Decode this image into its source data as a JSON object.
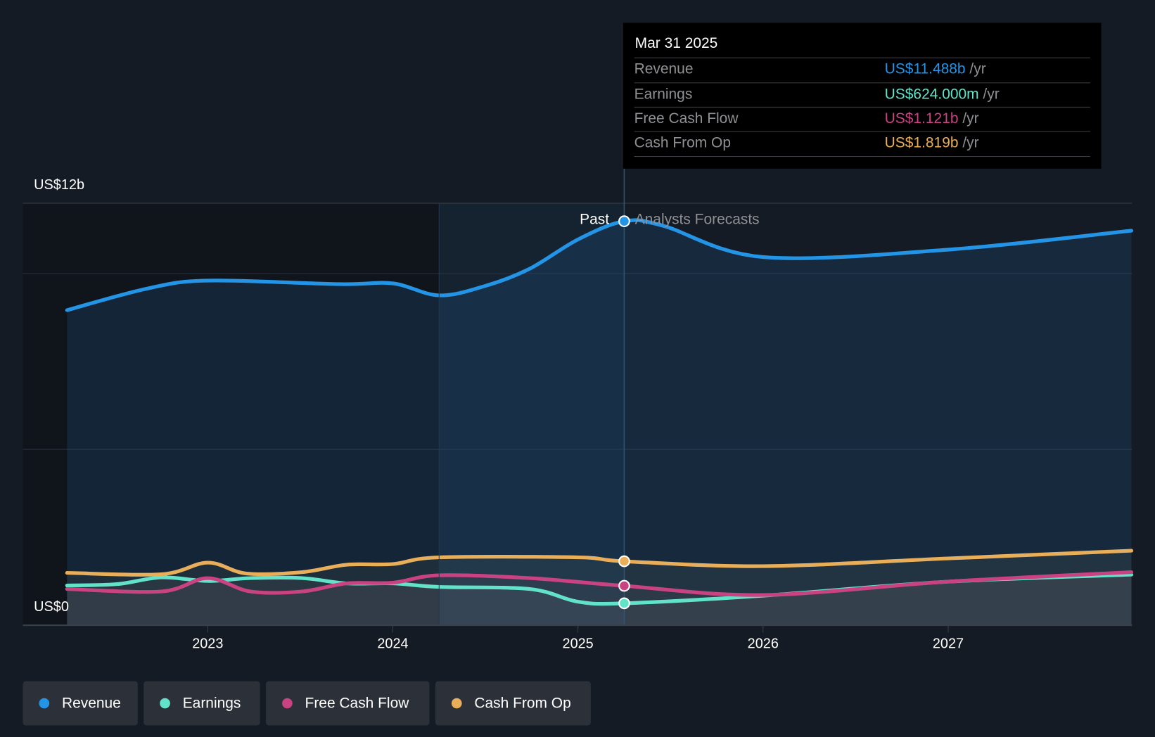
{
  "chart_data": {
    "type": "line",
    "title": "",
    "ylabel": "",
    "xlabel": "",
    "ylim": [
      0,
      12
    ],
    "xlim": [
      2022.24,
      2027.99
    ],
    "y_tick_labels": [
      "US$0",
      "US$12b"
    ],
    "x_ticks": [
      2023,
      2024,
      2025,
      2026,
      2027
    ],
    "x_tick_labels": [
      "2023",
      "2024",
      "2025",
      "2026",
      "2027"
    ],
    "past_label": "Past",
    "forecast_label": "Analysts Forecasts",
    "past_end": 2025.25,
    "highlight_start": 2024.25,
    "units": "US$ billions",
    "series": [
      {
        "name": "Revenue",
        "color": "#2394e6",
        "x": [
          2022.24,
          2022.67,
          2023.0,
          2023.71,
          2024.0,
          2024.25,
          2024.5,
          2024.74,
          2025.0,
          2025.25,
          2025.46,
          2026.0,
          2027.0,
          2027.99
        ],
        "values": [
          8.96,
          9.57,
          9.8,
          9.7,
          9.72,
          9.38,
          9.65,
          10.14,
          10.97,
          11.488,
          11.36,
          10.47,
          10.68,
          11.22
        ]
      },
      {
        "name": "Earnings",
        "color": "#62e3c9",
        "x": [
          2022.24,
          2022.51,
          2022.75,
          2023.0,
          2023.23,
          2023.51,
          2023.75,
          2024.0,
          2024.25,
          2024.74,
          2025.0,
          2025.25,
          2026.0,
          2027.0,
          2027.99
        ],
        "values": [
          1.13,
          1.17,
          1.36,
          1.26,
          1.34,
          1.34,
          1.19,
          1.19,
          1.09,
          1.03,
          0.67,
          0.624,
          0.84,
          1.24,
          1.44
        ]
      },
      {
        "name": "Free Cash Flow",
        "color": "#c94282",
        "x": [
          2022.24,
          2022.75,
          2023.0,
          2023.23,
          2023.51,
          2023.75,
          2024.0,
          2024.25,
          2024.74,
          2025.25,
          2026.0,
          2027.0,
          2027.99
        ],
        "values": [
          1.03,
          0.96,
          1.34,
          0.96,
          0.96,
          1.19,
          1.21,
          1.42,
          1.34,
          1.121,
          0.86,
          1.24,
          1.51
        ]
      },
      {
        "name": "Cash From Op",
        "color": "#e8ae5a",
        "x": [
          2022.24,
          2022.75,
          2023.0,
          2023.21,
          2023.51,
          2023.75,
          2024.0,
          2024.25,
          2025.0,
          2025.25,
          2026.0,
          2027.0,
          2027.99
        ],
        "values": [
          1.49,
          1.45,
          1.78,
          1.47,
          1.51,
          1.72,
          1.74,
          1.93,
          1.93,
          1.819,
          1.68,
          1.9,
          2.12
        ]
      }
    ]
  },
  "tooltip": {
    "date": "Mar 31 2025",
    "rows": [
      {
        "label": "Revenue",
        "value": "US$11.488b",
        "unit": "/yr",
        "color": "#2394e6"
      },
      {
        "label": "Earnings",
        "value": "US$624.000m",
        "unit": "/yr",
        "color": "#62e3c9"
      },
      {
        "label": "Free Cash Flow",
        "value": "US$1.121b",
        "unit": "/yr",
        "color": "#c94282"
      },
      {
        "label": "Cash From Op",
        "value": "US$1.819b",
        "unit": "/yr",
        "color": "#e8ae5a"
      }
    ]
  },
  "legend": [
    "Revenue",
    "Earnings",
    "Free Cash Flow",
    "Cash From Op"
  ]
}
